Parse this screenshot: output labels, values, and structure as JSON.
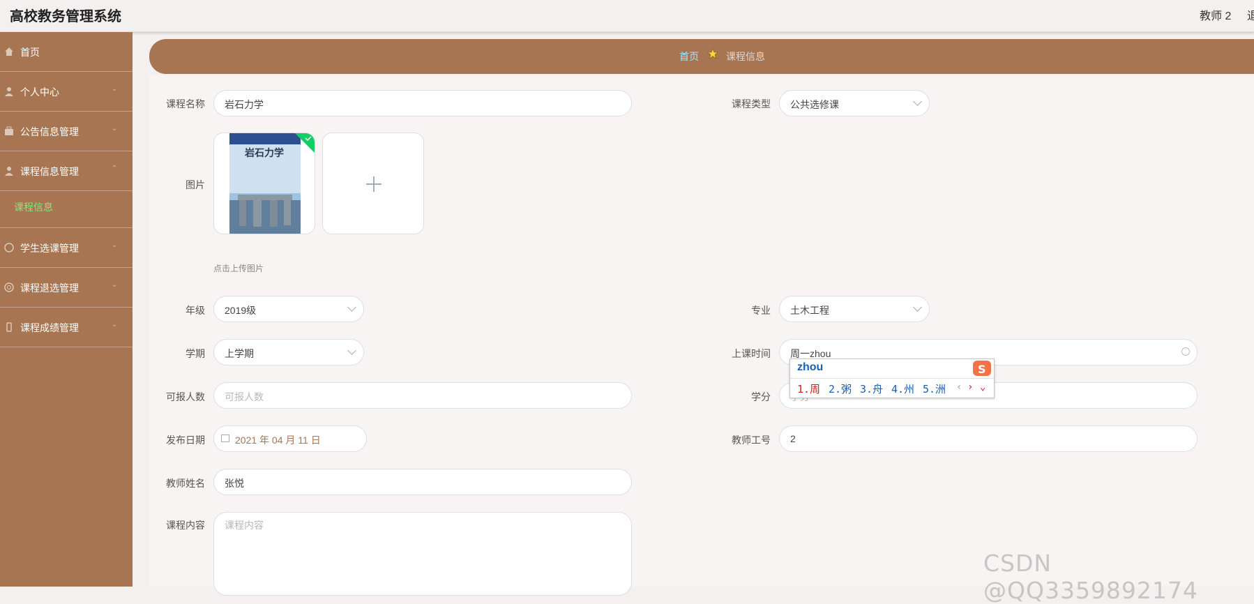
{
  "app": {
    "title": "高校教务管理系统",
    "user": "教师 2",
    "logout": "退出"
  },
  "sidebar": {
    "items": [
      {
        "label": "首页",
        "icon": "home-icon"
      },
      {
        "label": "个人中心",
        "icon": "user-icon"
      },
      {
        "label": "公告信息管理",
        "icon": "briefcase-icon"
      },
      {
        "label": "课程信息管理",
        "icon": "user-icon"
      },
      {
        "label": "学生选课管理",
        "icon": "compass-icon"
      },
      {
        "label": "课程退选管理",
        "icon": "at-icon"
      },
      {
        "label": "课程成绩管理",
        "icon": "phone-icon"
      }
    ],
    "submenu": {
      "label": "课程信息"
    },
    "active_sub_color": "#8fe37a"
  },
  "breadcrumb": {
    "home": "首页",
    "current": "课程信息"
  },
  "form": {
    "course_name": {
      "label": "课程名称",
      "value": "岩石力学"
    },
    "course_type": {
      "label": "课程类型",
      "value": "公共选修课"
    },
    "image": {
      "label": "图片",
      "hint": "点击上传图片",
      "book_title": "岩石力学"
    },
    "grade": {
      "label": "年级",
      "value": "2019级"
    },
    "major": {
      "label": "专业",
      "value": "土木工程"
    },
    "semester": {
      "label": "学期",
      "value": "上学期"
    },
    "class_time": {
      "label": "上课时间",
      "value": "周一zhou"
    },
    "capacity": {
      "label": "可报人数",
      "placeholder": "可报人数"
    },
    "credit": {
      "label": "学分",
      "placeholder": "学分"
    },
    "publish_date": {
      "label": "发布日期",
      "value": "2021 年 04 月 11 日"
    },
    "teacher_id": {
      "label": "教师工号",
      "value": "2"
    },
    "teacher_name": {
      "label": "教师姓名",
      "value": "张悦"
    },
    "content": {
      "label": "课程内容",
      "placeholder": "课程内容"
    }
  },
  "ime": {
    "composition": "zhou",
    "candidates": [
      "1.周",
      "2.粥",
      "3.舟",
      "4.州",
      "5.洲"
    ]
  },
  "watermark": "CSDN @QQ3359892174",
  "colors": {
    "sidebar": "#a77552",
    "breadcrumb_home": "#a5e5ff"
  }
}
